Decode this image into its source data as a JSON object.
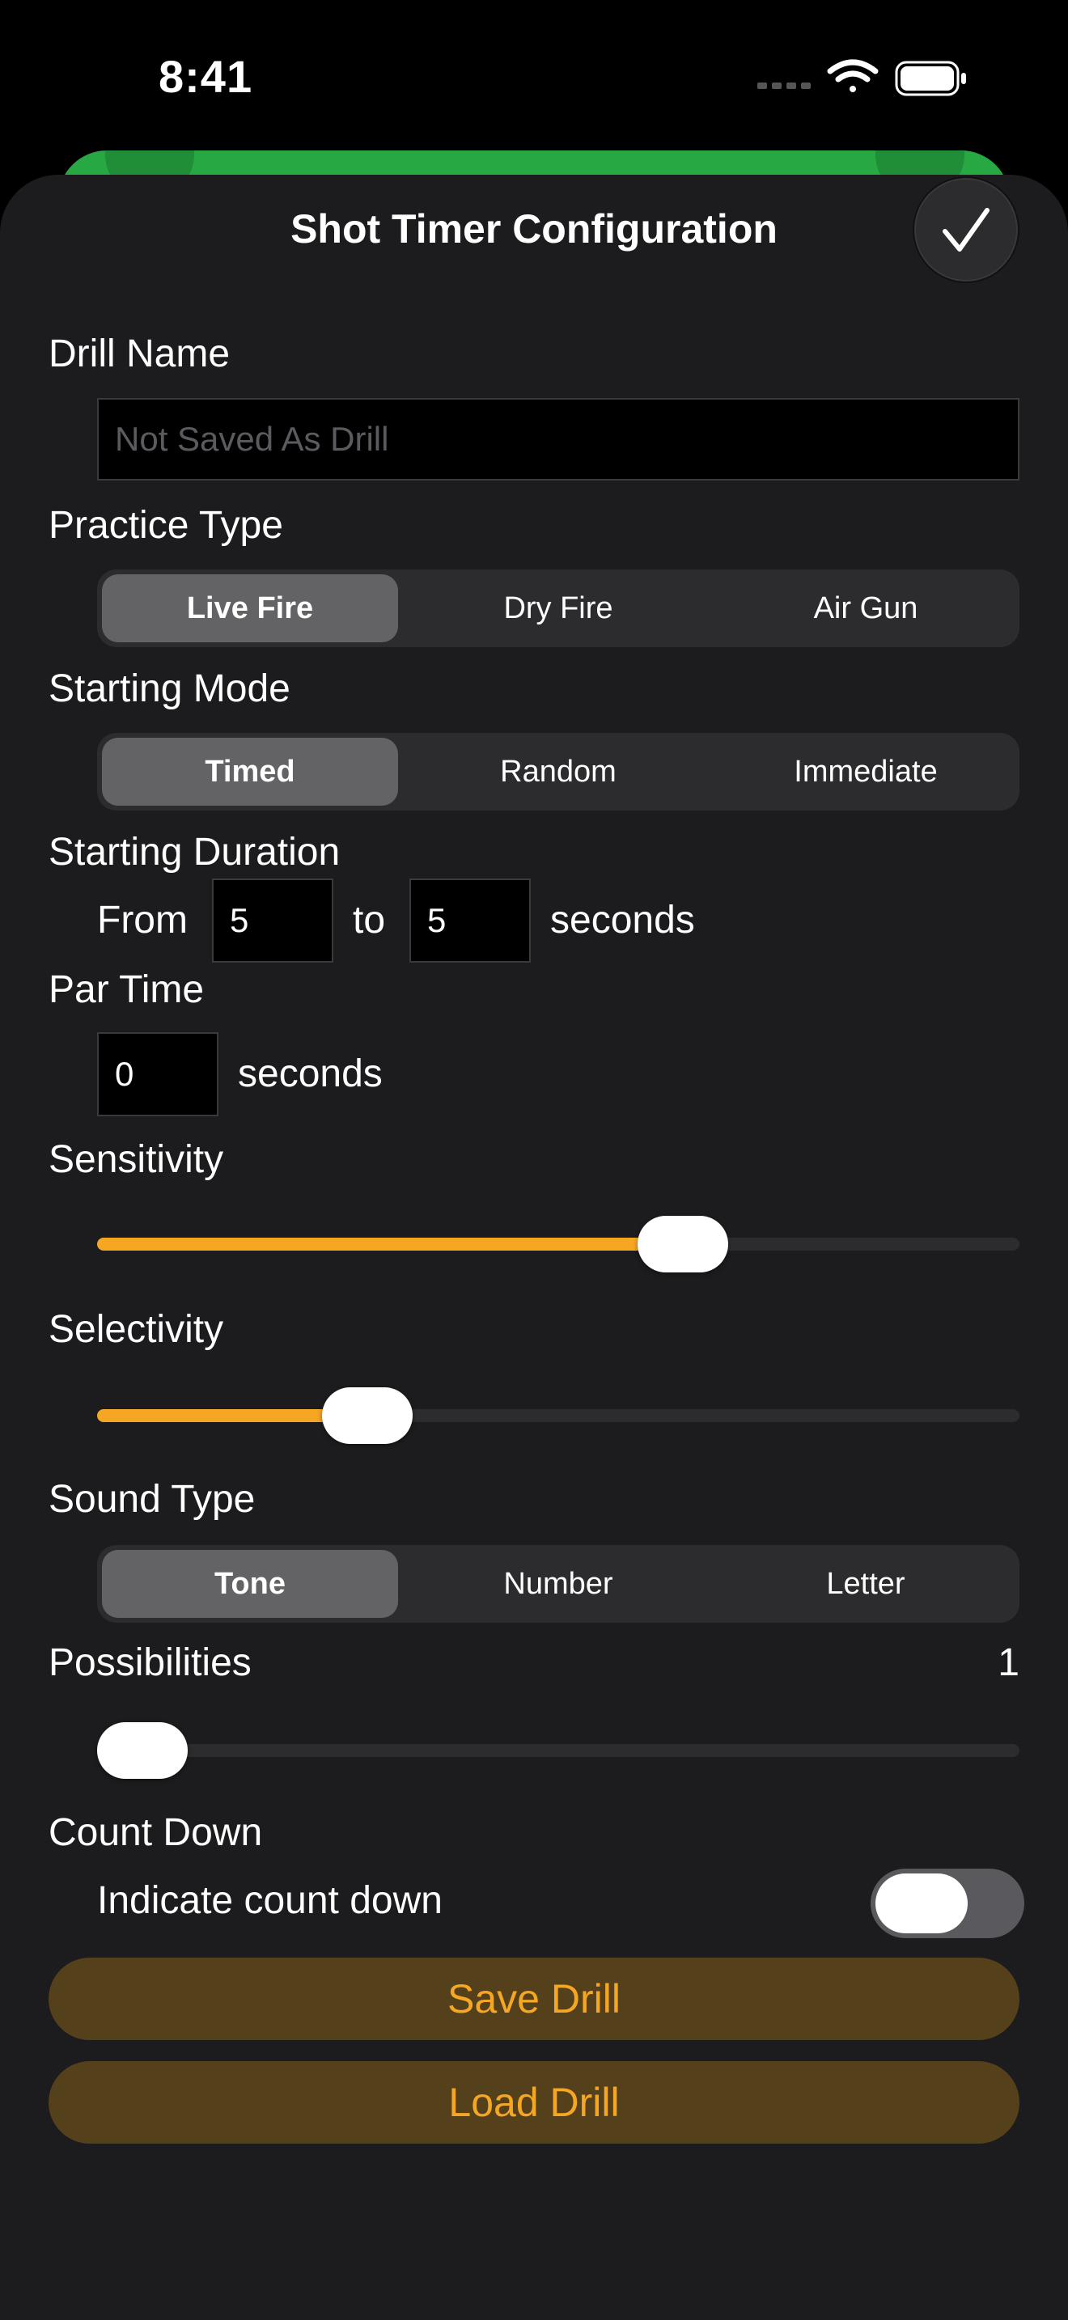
{
  "status": {
    "time": "8:41"
  },
  "header": {
    "title": "Shot Timer Configuration"
  },
  "drill_name": {
    "label": "Drill Name",
    "placeholder": "Not Saved As Drill",
    "value": ""
  },
  "practice_type": {
    "label": "Practice Type",
    "options": [
      "Live Fire",
      "Dry Fire",
      "Air Gun"
    ],
    "selected": "Live Fire"
  },
  "starting_mode": {
    "label": "Starting Mode",
    "options": [
      "Timed",
      "Random",
      "Immediate"
    ],
    "selected": "Timed"
  },
  "starting_duration": {
    "label": "Starting Duration",
    "from_label": "From",
    "from_value": "5",
    "to_label": "to",
    "to_value": "5",
    "unit": "seconds"
  },
  "par_time": {
    "label": "Par Time",
    "value": "0",
    "unit": "seconds"
  },
  "sensitivity": {
    "label": "Sensitivity",
    "level": 0.65
  },
  "selectivity": {
    "label": "Selectivity",
    "level": 0.27
  },
  "sound_type": {
    "label": "Sound Type",
    "options": [
      "Tone",
      "Number",
      "Letter"
    ],
    "selected": "Tone"
  },
  "possibilities": {
    "label": "Possibilities",
    "value": "1",
    "level": 0.0
  },
  "count_down": {
    "label": "Count Down",
    "toggle_label": "Indicate count down",
    "enabled": false
  },
  "actions": {
    "save_label": "Save Drill",
    "load_label": "Load Drill"
  },
  "colors": {
    "accent": "#f5a623",
    "background": "#1c1c1e",
    "button_bg": "#55401c"
  },
  "icons": {
    "done": "checkmark-icon",
    "wifi": "wifi-icon",
    "battery": "battery-icon",
    "signal": "signal-icon"
  }
}
